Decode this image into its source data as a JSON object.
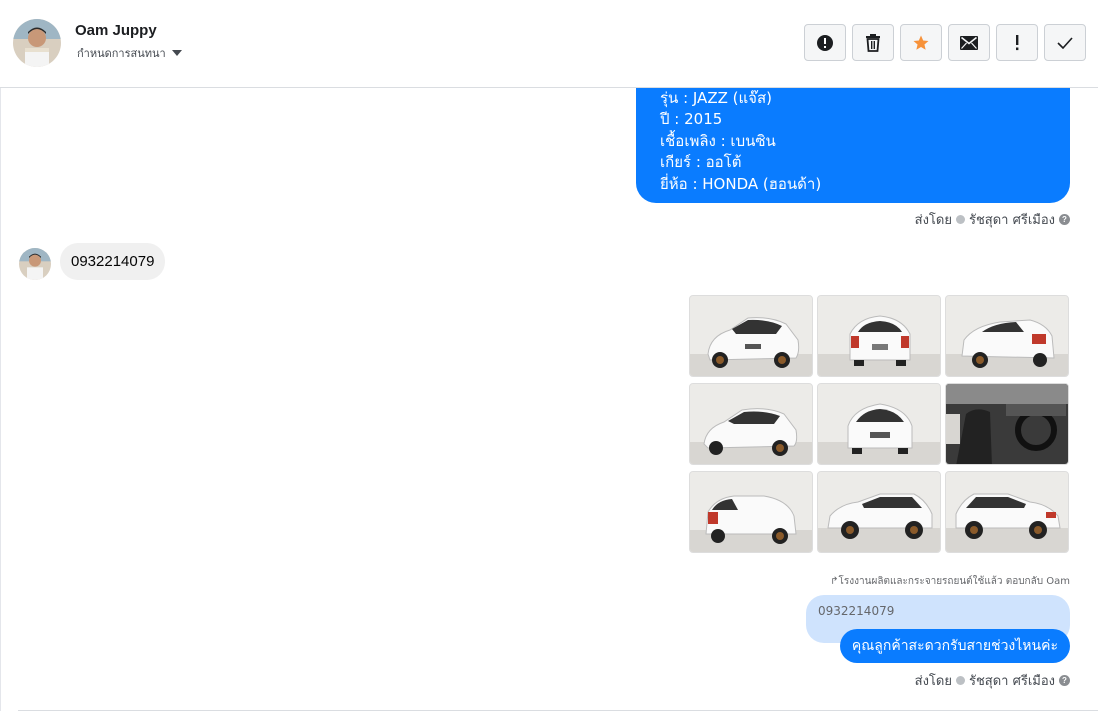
{
  "header": {
    "contact_name": "Oam Juppy",
    "subtitle": "กำหนดการสนทนา"
  },
  "toolbar": [
    {
      "name": "report-button",
      "icon": "alert-circle-icon"
    },
    {
      "name": "delete-button",
      "icon": "trash-icon"
    },
    {
      "name": "star-button",
      "icon": "star-icon",
      "color": "#f7923a"
    },
    {
      "name": "mail-button",
      "icon": "envelope-icon"
    },
    {
      "name": "important-button",
      "icon": "exclamation-icon"
    },
    {
      "name": "done-button",
      "icon": "check-icon"
    }
  ],
  "messages": {
    "car_info_lines": [
      "รุ่น : JAZZ (แจ๊ส)",
      "ปี : 2015",
      "เชื้อเพลิง : เบนซิน",
      "เกียร์ : ออโต้",
      "ยี่ห้อ : HONDA (ฮอนด้า)"
    ],
    "sent_by_label": "ส่งโดย",
    "sent_by_name": "รัชสุดา ศรีเมือง",
    "customer_phone": "0932214079",
    "reply_note": "โรงงานผลิตและกระจายรถยนต์ใช้แล้ว ตอบกลับ Oam",
    "quoted_text": "0932214079",
    "reply_text": "คุณลูกค้าสะดวกรับสายช่วงไหนค่ะ"
  },
  "colors": {
    "accent_blue": "#0a7cff",
    "quote_blue": "#cfe3fd",
    "star": "#f7923a"
  }
}
